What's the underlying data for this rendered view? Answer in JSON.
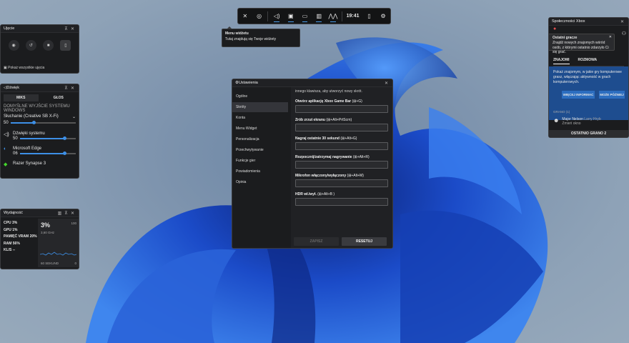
{
  "topbar": {
    "time": "19:41",
    "icons": [
      "xbox-icon",
      "controller-icon",
      "audio-icon",
      "capture-icon",
      "performance-icon",
      "resources-icon",
      "gallery-icon",
      "phone-icon",
      "settings-icon"
    ]
  },
  "tooltip": {
    "title": "Menu widżetu",
    "body": "Tutaj znajdują się Twoje widżety"
  },
  "capture": {
    "title": "Ujęcie",
    "show_all": "Pokaż wszystkie ujęcia"
  },
  "audio": {
    "title": "Dźwięk",
    "tab_mix": "MIKS",
    "tab_voice": "GŁOS",
    "device_section": "DOMYŚLNE WYJŚCIE SYSTEMU WINDOWS",
    "device": "Słuchanie (Creative SB X-Fi)",
    "master_value": "50",
    "master_level": 0.35,
    "apps": [
      {
        "name": "Dźwięki systemu",
        "value": "50",
        "level": 0.8
      },
      {
        "name": "Microsoft Edge",
        "value": "06",
        "level": 0.8
      },
      {
        "name": "Razer Synapse 3",
        "value": "",
        "level": 0
      }
    ]
  },
  "performance": {
    "title": "Wydajność",
    "rows": [
      "CPU   3%",
      "GPU   1%",
      "PAMIĘĆ VRAM   20%",
      "RAM   56%",
      "KL/S   --"
    ],
    "big": "3%",
    "freq": "3,60 GHz",
    "max": "100",
    "duration": "60 SEKUND",
    "min": "0"
  },
  "settings": {
    "title": "Ustawienia",
    "nav": [
      "Ogólne",
      "Skróty",
      "Konta",
      "Menu Widget",
      "Personalizacja",
      "Przechwytywanie",
      "Funkcje gier",
      "Powiadomienia",
      "Opinia"
    ],
    "selected": 1,
    "intro": "innego klawisza, aby utworzyć nowy skrót.",
    "shortcuts": [
      {
        "label": "Otwórz aplikację Xbox Game Bar",
        "keys": "(⊞+G)"
      },
      {
        "label": "Zrób zrzut ekranu",
        "keys": "(⊞+Alt+PrtScrn)"
      },
      {
        "label": "Nagraj ostatnie 30 sekund",
        "keys": "(⊞+Alt+G)"
      },
      {
        "label": "Rozpocznij/zatrzymaj nagrywanie",
        "keys": "(⊞+Alt+R)"
      },
      {
        "label": "Mikrofon włączony/wyłączony",
        "keys": "(⊞+Alt+M)"
      },
      {
        "label": "HDR wł./wył.",
        "keys": "(⊞+Alt+B )"
      }
    ],
    "save": "ZAPISZ",
    "reset": "RESETUJ"
  },
  "social": {
    "title": "Społeczności Xbox",
    "recent_title": "Ostatni gracze",
    "recent_desc": "Znajdź nowych znajomych wśród osób, z którymi ostatnio zdarzyło Ci się grać.",
    "tab_friends": "ZNAJOMI",
    "tab_chat": "ROZMOWA",
    "promo": "Pokaż znajomym, w jakie gry komputerowe grasz, włączając aktywność w grach komputerowych.",
    "more_info": "WIĘCEJ INFORMAC",
    "later": "MOŻE PÓŹNIEJ",
    "group": "GRANO (1)",
    "player_name": "Major Nelson",
    "player_real": "Larry Hryb",
    "player_status": "Zmień okno",
    "footer": "OSTATNIO GRANO 2"
  },
  "colors": {
    "accent": "#3d8fe6",
    "panel": "#1b1c1e"
  }
}
